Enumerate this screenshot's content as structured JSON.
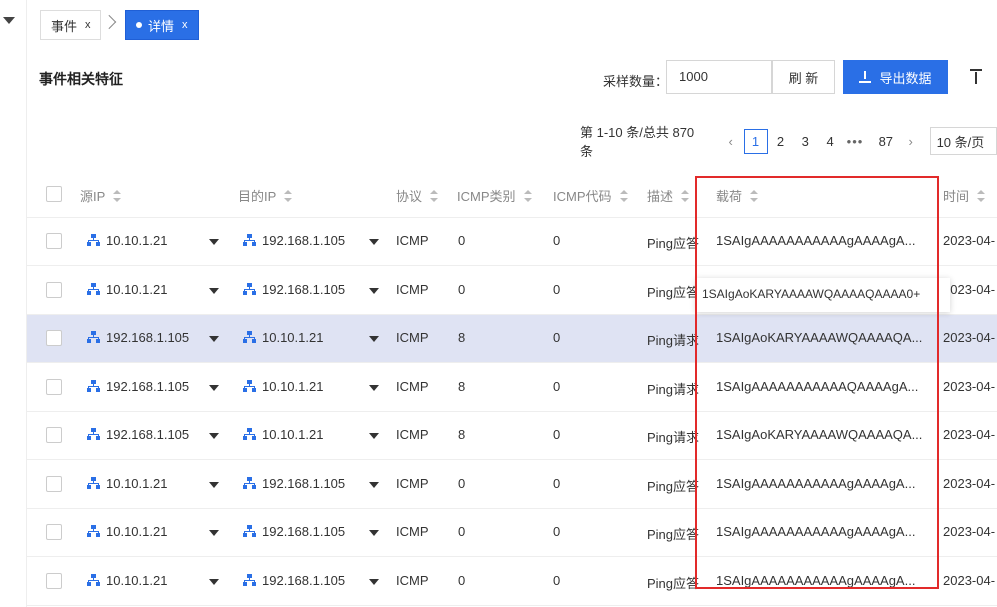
{
  "tabs": [
    {
      "label": "事件",
      "close": "x"
    },
    {
      "label": "详情",
      "close": "x"
    }
  ],
  "section_title": "事件相关特征",
  "toolbar": {
    "sample_label": "采样数量：",
    "sample_value": "1000",
    "refresh_label": "刷 新",
    "export_label": "导出数据"
  },
  "pagination": {
    "summary": "第 1-10 条/总共 870 条",
    "pages": [
      "1",
      "2",
      "3",
      "4",
      "•••",
      "87"
    ],
    "current": "1",
    "page_size": "10 条/页"
  },
  "table": {
    "columns": [
      "源IP",
      "目的IP",
      "协议",
      "ICMP类别",
      "ICMP代码",
      "描述",
      "载荷",
      "时间"
    ],
    "rows": [
      {
        "src": "10.10.1.21",
        "dst": "192.168.1.105",
        "proto": "ICMP",
        "type": "0",
        "code": "0",
        "desc": "Ping应答",
        "payload": "1SAIgAAAAAAAAAAAgAAAAgA...",
        "time": "2023-04-"
      },
      {
        "src": "10.10.1.21",
        "dst": "192.168.1.105",
        "proto": "ICMP",
        "type": "0",
        "code": "0",
        "desc": "Ping应答",
        "payload": "",
        "time": "2023-04-"
      },
      {
        "src": "192.168.1.105",
        "dst": "10.10.1.21",
        "proto": "ICMP",
        "type": "8",
        "code": "0",
        "desc": "Ping请求",
        "payload": "1SAIgAoKARYAAAAWQAAAAQA...",
        "time": "2023-04-"
      },
      {
        "src": "192.168.1.105",
        "dst": "10.10.1.21",
        "proto": "ICMP",
        "type": "8",
        "code": "0",
        "desc": "Ping请求",
        "payload": "1SAIgAAAAAAAAAAAQAAAAgA...",
        "time": "2023-04-"
      },
      {
        "src": "192.168.1.105",
        "dst": "10.10.1.21",
        "proto": "ICMP",
        "type": "8",
        "code": "0",
        "desc": "Ping请求",
        "payload": "1SAIgAoKARYAAAAWQAAAAQA...",
        "time": "2023-04-"
      },
      {
        "src": "10.10.1.21",
        "dst": "192.168.1.105",
        "proto": "ICMP",
        "type": "0",
        "code": "0",
        "desc": "Ping应答",
        "payload": "1SAIgAAAAAAAAAAAgAAAAgA...",
        "time": "2023-04-"
      },
      {
        "src": "10.10.1.21",
        "dst": "192.168.1.105",
        "proto": "ICMP",
        "type": "0",
        "code": "0",
        "desc": "Ping应答",
        "payload": "1SAIgAAAAAAAAAAAgAAAAgA...",
        "time": "2023-04-"
      },
      {
        "src": "10.10.1.21",
        "dst": "192.168.1.105",
        "proto": "ICMP",
        "type": "0",
        "code": "0",
        "desc": "Ping应答",
        "payload": "1SAIgAAAAAAAAAAAgAAAAgA...",
        "time": "2023-04-"
      }
    ],
    "selected_row": 2
  },
  "tooltip": {
    "text": "1SAIgAoKARYAAAAWQAAAAQAAAA0+"
  },
  "colors": {
    "primary": "#2a6fe6",
    "highlight_border": "#e22a2a",
    "selected_row": "#dfe3f3"
  },
  "icons": {
    "network": "network-icon",
    "download": "download-icon",
    "dropdown": "caret-down-icon"
  }
}
